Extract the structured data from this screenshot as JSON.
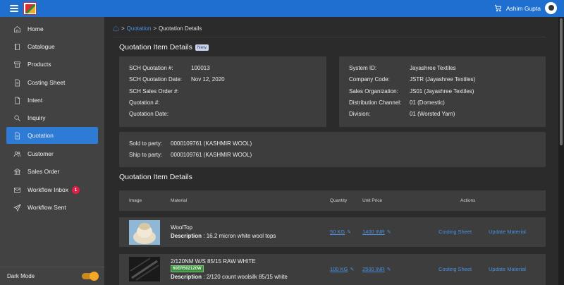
{
  "header": {
    "user_name": "Ashim Gupta",
    "cart_icon": "cart-icon"
  },
  "sidebar": {
    "items": [
      {
        "label": "Home",
        "icon": "home-icon"
      },
      {
        "label": "Catalogue",
        "icon": "book-icon"
      },
      {
        "label": "Products",
        "icon": "archive-icon"
      },
      {
        "label": "Costing Sheet",
        "icon": "document-icon"
      },
      {
        "label": "Intent",
        "icon": "file-icon"
      },
      {
        "label": "Inquiry",
        "icon": "search-icon"
      },
      {
        "label": "Quotation",
        "icon": "document-icon",
        "active": true
      },
      {
        "label": "Customer",
        "icon": "users-icon"
      },
      {
        "label": "Sales Order",
        "icon": "bank-icon"
      },
      {
        "label": "Workflow Inbox",
        "icon": "inbox-icon",
        "badge": "1"
      },
      {
        "label": "Workflow Sent",
        "icon": "send-icon"
      }
    ],
    "dark_mode_label": "Dark Mode",
    "dark_mode_on": true
  },
  "breadcrumb": {
    "parent": "Quotation",
    "separator": ">",
    "current": "Quotation Details"
  },
  "details": {
    "title": "Quotation Item Details",
    "new_badge": "New",
    "left": [
      {
        "label": "SCH Quotation #:",
        "value": "100013"
      },
      {
        "label": "SCH Quotation Date:",
        "value": "Nov 12, 2020"
      },
      {
        "label": "SCH Sales Order #:",
        "value": ""
      },
      {
        "label": "Quotation #:",
        "value": ""
      },
      {
        "label": "Quotation Date:",
        "value": ""
      }
    ],
    "right": [
      {
        "label": "System ID:",
        "value": "Jayashree Textiles"
      },
      {
        "label": "Company Code:",
        "value": "JSTR (Jayashree Textiles)"
      },
      {
        "label": "Sales Organization:",
        "value": "JS01 (Jayashree Textiles)"
      },
      {
        "label": "Distribution Channel:",
        "value": "01 (Domestic)"
      },
      {
        "label": "Division:",
        "value": "01 (Worsted Yarn)"
      }
    ],
    "party": [
      {
        "label": "Sold to party:",
        "value": "0000109761 (KASHMIR WOOL)"
      },
      {
        "label": "Ship to party:",
        "value": "0000109761 (KASHMIR WOOL)"
      }
    ]
  },
  "items": {
    "title": "Quotation Item Details",
    "columns": [
      "Image",
      "Material",
      "Quantity",
      "Unit Price",
      "Actions"
    ],
    "rows": [
      {
        "name": "WoolTop",
        "code": "",
        "description_label": "Description",
        "description": ": 16.2 micron white wool tops",
        "quantity": "50 KG",
        "unit_price": "1400 INR",
        "action_1": "Costing Sheet",
        "action_2": "Update Material"
      },
      {
        "name": "2/120NM W/S 85/15 RAW WHITE",
        "code": "60ER502120W",
        "description_label": "Description",
        "description": ": 2/120 count woolsilk 85/15 white",
        "quantity": "100 KG",
        "unit_price": "2500 INR",
        "action_1": "Costing Sheet",
        "action_2": "Update Material"
      }
    ]
  },
  "colors": {
    "accent": "#2e7bd6",
    "topbar": "#1f6fd1",
    "badge": "#e11d48",
    "toggle": "#f5a623",
    "code_badge": "#3d8b3d"
  }
}
